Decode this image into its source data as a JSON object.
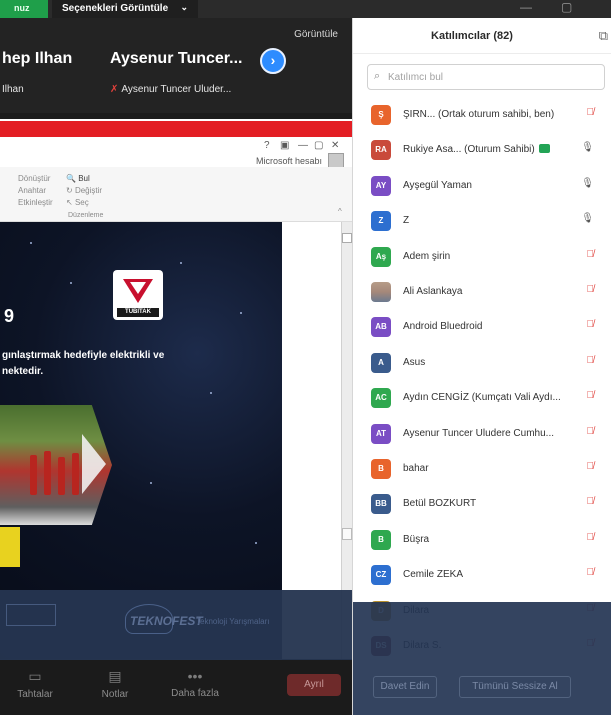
{
  "topbar": {
    "green_label": "nuz",
    "view_options_label": "Seçenekleri Görüntüle",
    "minimize": "—",
    "restore": "▢"
  },
  "gallery": {
    "view_label": "Görüntüle",
    "tiles": [
      {
        "name": "hep Ilhan",
        "subname": "Ilhan"
      },
      {
        "name": "Aysenur Tuncer...",
        "subname": "Aysenur Tuncer Uluder..."
      }
    ]
  },
  "share": {
    "account_label": "Microsoft hesabı",
    "ribbon": {
      "texts": [
        "Dönüştür",
        "Anahtar",
        "Etkinleştir",
        "Bul",
        "Değiştir",
        "Seç",
        "Düzenleme"
      ]
    },
    "slide": {
      "number": "9",
      "logo_text": "TÜBİTAK",
      "text_line1": "gınlaştırmak hedefiyle elektrikli ve",
      "text_line2": "nektedir.",
      "footer_sub": "Teknoloji Yarışmaları"
    }
  },
  "controls": {
    "items": [
      {
        "label": "Tahtalar"
      },
      {
        "label": "Notlar"
      },
      {
        "label": "Daha fazla"
      }
    ],
    "end_label": "Ayrıl"
  },
  "panel": {
    "title": "Katılımcılar (82)",
    "search_placeholder": "Katılımcı bul",
    "participants": [
      {
        "initials": "Ş",
        "name": "ŞIRN... (Ortak oturum sahibi, ben)",
        "color": "#e8642c",
        "muted": true
      },
      {
        "initials": "RA",
        "name": "Rukiye Asa... (Oturum Sahibi)",
        "color": "#c94a3b",
        "muted": false,
        "video": true
      },
      {
        "initials": "AY",
        "name": "Ayşegül Yaman",
        "color": "#7a4dc4",
        "muted": false
      },
      {
        "initials": "Z",
        "name": "Z",
        "color": "#2d6fd0",
        "muted": false
      },
      {
        "initials": "Aş",
        "name": "Adem şirin",
        "color": "#2fa84f",
        "muted": true
      },
      {
        "initials": "",
        "name": "Ali Aslankaya",
        "color": "#9a8a7f",
        "muted": true,
        "photo": true
      },
      {
        "initials": "AB",
        "name": "Android Bluedroid",
        "color": "#7a4dc4",
        "muted": true
      },
      {
        "initials": "A",
        "name": "Asus",
        "color": "#3a5b8c",
        "muted": true
      },
      {
        "initials": "AC",
        "name": "Aydın CENGİZ (Kumçatı Vali Aydı...",
        "color": "#2fa84f",
        "muted": true
      },
      {
        "initials": "AT",
        "name": "Aysenur Tuncer Uludere Cumhu...",
        "color": "#7a4dc4",
        "muted": true
      },
      {
        "initials": "B",
        "name": "bahar",
        "color": "#e8642c",
        "muted": true
      },
      {
        "initials": "BB",
        "name": "Betül BOZKURT",
        "color": "#3a5b8c",
        "muted": true
      },
      {
        "initials": "B",
        "name": "Büşra",
        "color": "#2fa84f",
        "muted": true
      },
      {
        "initials": "CZ",
        "name": "Cemile ZEKA",
        "color": "#2d6fd0",
        "muted": true
      },
      {
        "initials": "D",
        "name": "Dilara",
        "color": "#b8902c",
        "muted": true
      },
      {
        "initials": "DS",
        "name": "Dilara S.",
        "color": "#8a3a3a",
        "muted": true
      }
    ],
    "invite_label": "Davet Edin",
    "mute_all_label": "Tümünü Sessize Al"
  }
}
